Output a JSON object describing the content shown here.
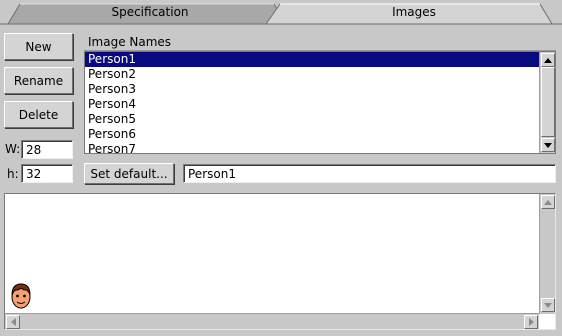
{
  "tabs": [
    {
      "label": "Specification",
      "active": false
    },
    {
      "label": "Images",
      "active": true
    }
  ],
  "buttons": {
    "new": "New",
    "rename": "Rename",
    "delete": "Delete",
    "set_default": "Set default..."
  },
  "size": {
    "w_label": "W:",
    "w_value": "28",
    "h_label": "h:",
    "h_value": "32"
  },
  "image_list": {
    "header": "Image Names",
    "items": [
      "Person1",
      "Person2",
      "Person3",
      "Person4",
      "Person5",
      "Person6",
      "Person7"
    ],
    "selected": "Person1"
  },
  "default_field": {
    "value": "Person1"
  },
  "preview": {
    "icon": "person-face-icon"
  },
  "colors": {
    "selection": "#0a0a80",
    "background": "#c8c8c8"
  }
}
